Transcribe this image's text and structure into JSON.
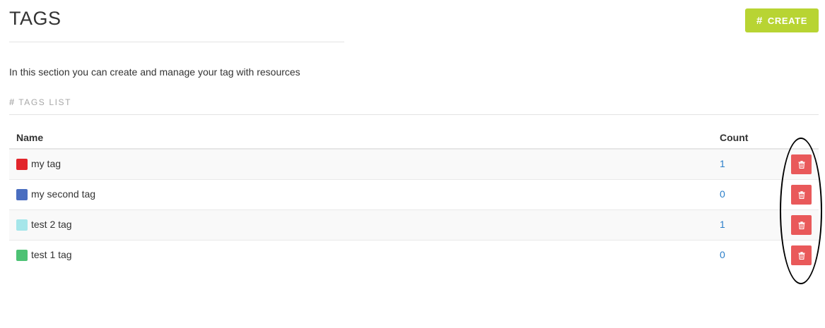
{
  "header": {
    "title": "TAGS",
    "create_label": "CREATE",
    "create_icon": "#"
  },
  "intro_text": "In this section you can create and manage your tag with resources",
  "section": {
    "icon": "#",
    "label": "TAGS LIST"
  },
  "table": {
    "columns": {
      "name": "Name",
      "count": "Count"
    },
    "rows": [
      {
        "name": "my tag",
        "color": "#e2252b",
        "count": "1"
      },
      {
        "name": "my second tag",
        "color": "#4a6ec0",
        "count": "0"
      },
      {
        "name": "test 2 tag",
        "color": "#a5e6ea",
        "count": "1"
      },
      {
        "name": "test 1 tag",
        "color": "#4dc274",
        "count": "0"
      }
    ]
  },
  "colors": {
    "create_button": "#b8d433",
    "delete_button": "#e9595a",
    "link": "#2a7ec9"
  },
  "icons": {
    "delete": "trash-icon",
    "create": "hash-icon"
  }
}
